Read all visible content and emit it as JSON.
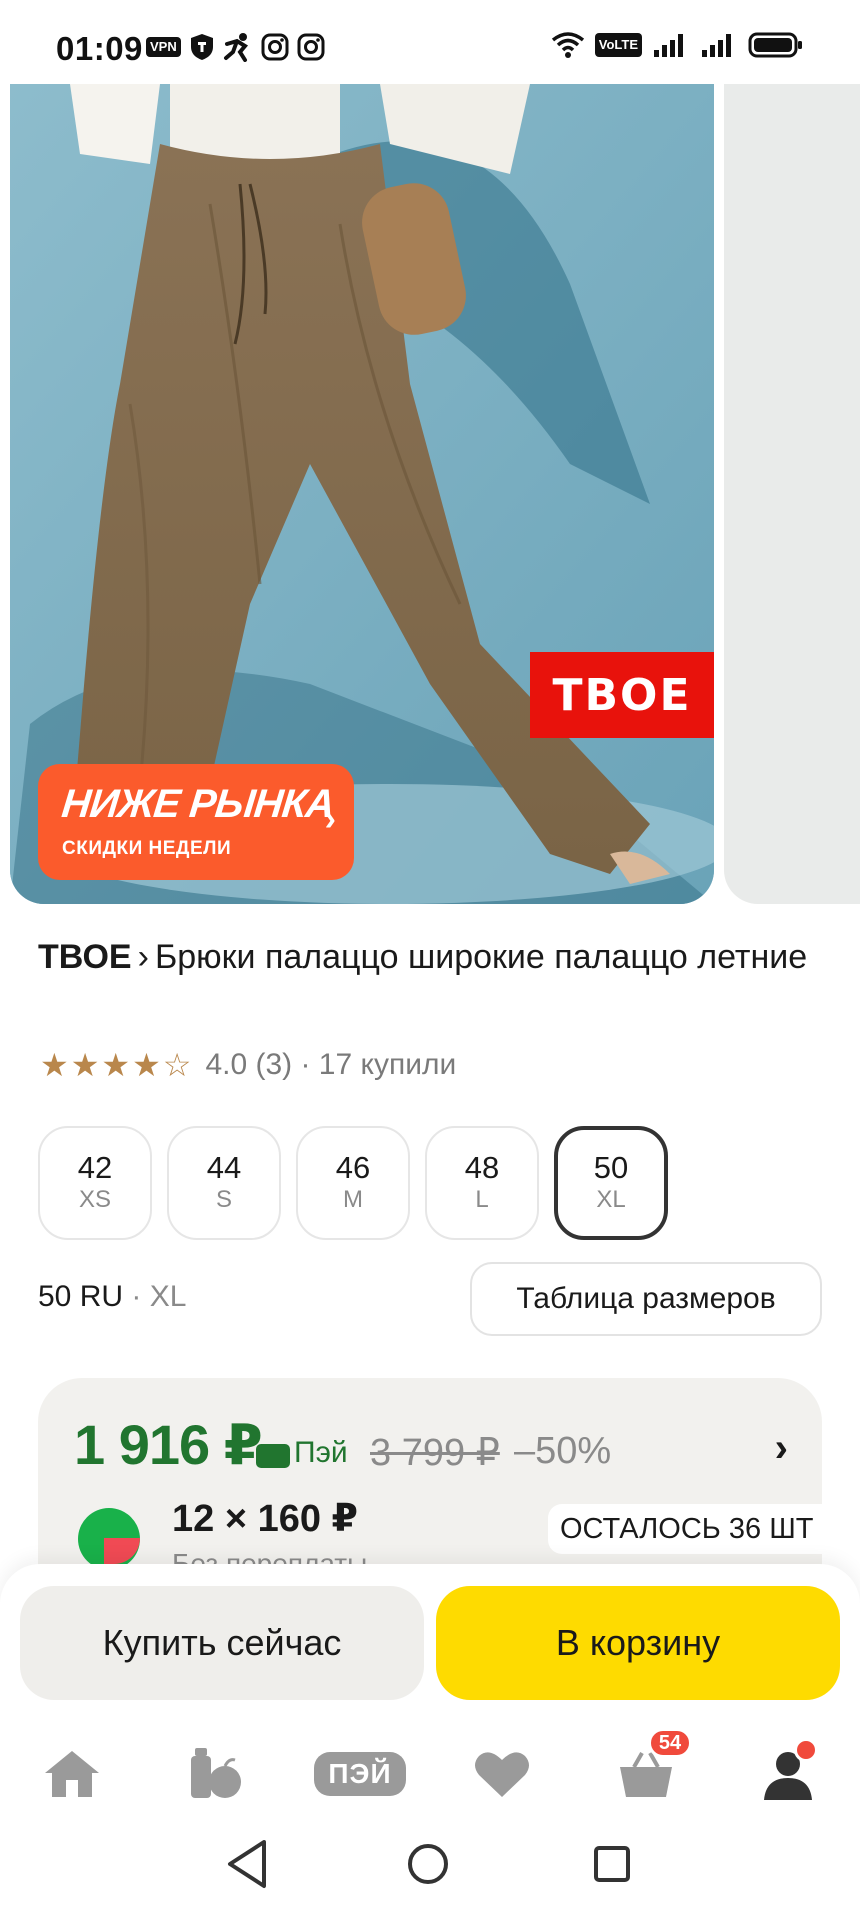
{
  "status_bar": {
    "time": "01:09",
    "vpn_label": "VPN",
    "volte_label": "VoLTE"
  },
  "gallery": {
    "brand_badge": "ТВОЕ",
    "promo_title": "НИЖЕ РЫНКА",
    "promo_subtitle": "СКИДКИ НЕДЕЛИ"
  },
  "product": {
    "brand": "ТВОЕ",
    "name": "Брюки палаццо широкие палаццо летние",
    "rating_value": 4.0,
    "rating_text": "4.0 (3) · 17 купили"
  },
  "sizes": [
    {
      "num": "42",
      "letter": "XS",
      "selected": false
    },
    {
      "num": "44",
      "letter": "S",
      "selected": false
    },
    {
      "num": "46",
      "letter": "M",
      "selected": false
    },
    {
      "num": "48",
      "letter": "L",
      "selected": false
    },
    {
      "num": "50",
      "letter": "XL",
      "selected": true
    }
  ],
  "size_info": {
    "ru": "50 RU",
    "intl": " · XL",
    "table_button": "Таблица размеров"
  },
  "price": {
    "current": "1 916 ₽",
    "pay_label": "Пэй",
    "old": "3 799 ₽",
    "discount": "–50%",
    "split_amount": "12 × 160 ₽",
    "split_sub": "Без переплаты",
    "stock": "ОСТАЛОСЬ 36 ШТ"
  },
  "actions": {
    "buy_now": "Купить сейчас",
    "add_to_cart": "В корзину"
  },
  "nav": {
    "pay_label": "ПЭЙ",
    "cart_badge": "54"
  },
  "colors": {
    "price_green": "#21752f",
    "cart_yellow": "#fedb00",
    "promo_orange": "#fb5b2c",
    "brand_red": "#e8120c",
    "star": "#b9874c"
  }
}
